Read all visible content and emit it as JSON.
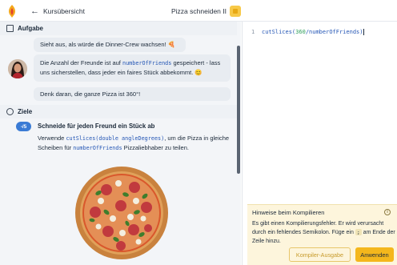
{
  "app": {
    "back_label": "Kursübersicht",
    "title": "Pizza schneiden II"
  },
  "aufgabe": {
    "heading": "Aufgabe",
    "messages": [
      {
        "text": "Sieht aus, als würde die Dinner-Crew wachsen! 🍕"
      },
      {
        "pre": "Die Anzahl der Freunde ist auf ",
        "code": "numberOfFriends",
        "post": " gespeichert - lass uns sicherstellen, dass jeder ein faires Stück abbekommt. 😊"
      },
      {
        "text": "Denk daran, die ganze Pizza ist 360°!"
      }
    ]
  },
  "ziele": {
    "heading": "Ziele",
    "badge": "-/5",
    "task_title": "Schneide für jeden Freund ein Stück ab",
    "desc_pre": "Verwende ",
    "desc_code1": "cutSlices(double angleDegrees)",
    "desc_mid": ", um die Pizza in gleiche Scheiben für ",
    "desc_code2": "numberOfFriends",
    "desc_post": " Pizzaliebhaber zu teilen."
  },
  "editor": {
    "line_number": "1",
    "code_pre": "cutSlices(",
    "code_num": "360",
    "code_post": "/numberOfFriends)"
  },
  "hint": {
    "title": "Hinweise beim Kompilieren",
    "info_glyph": "i",
    "text_pre": "Es gibt einen Kompilierungsfehler. Er wird verursacht durch ein fehlendes Semikolon. Füge ein ",
    "text_code": ";",
    "text_post": " am Ende der Zeile hinzu.",
    "output_button": "Kompiler-Ausgabe",
    "apply_button": "Anwenden"
  }
}
